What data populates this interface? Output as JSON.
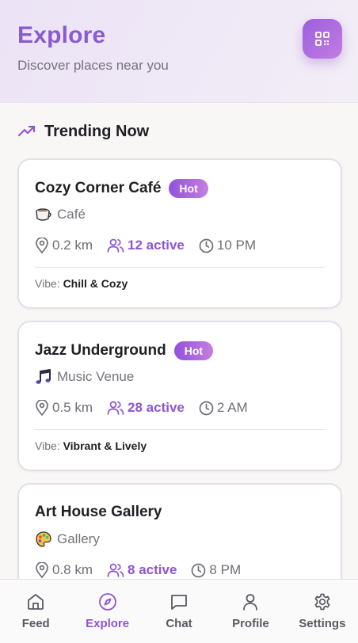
{
  "header": {
    "title": "Explore",
    "subtitle": "Discover places near you",
    "qr_icon": "qr-code-icon"
  },
  "trending": {
    "title": "Trending Now",
    "icon": "trending-up-icon"
  },
  "cards": [
    {
      "name": "Cozy Corner Café",
      "badge": "Hot",
      "type_emoji": "coffee-cup-icon",
      "type": "Café",
      "distance": "0.2 km",
      "active": "12 active",
      "hours": "10 PM",
      "vibe_label": "Vibe:",
      "vibe": "Chill & Cozy"
    },
    {
      "name": "Jazz Underground",
      "badge": "Hot",
      "type_emoji": "music-notes-icon",
      "type": "Music Venue",
      "distance": "0.5 km",
      "active": "28 active",
      "hours": "2 AM",
      "vibe_label": "Vibe:",
      "vibe": "Vibrant & Lively"
    },
    {
      "name": "Art House Gallery",
      "badge": "",
      "type_emoji": "palette-icon",
      "type": "Gallery",
      "distance": "0.8 km",
      "active": "8 active",
      "hours": "8 PM"
    }
  ],
  "nav": {
    "items": [
      {
        "label": "Feed",
        "icon": "home-icon",
        "active": false
      },
      {
        "label": "Explore",
        "icon": "compass-icon",
        "active": true
      },
      {
        "label": "Chat",
        "icon": "chat-bubble-icon",
        "active": false
      },
      {
        "label": "Profile",
        "icon": "person-icon",
        "active": false
      },
      {
        "label": "Settings",
        "icon": "gear-icon",
        "active": false
      }
    ]
  },
  "colors": {
    "accent": "#8e55d2",
    "badge_gradient_start": "#9152dd",
    "badge_gradient_end": "#c47fde",
    "header_title": "#8a5ad0"
  }
}
